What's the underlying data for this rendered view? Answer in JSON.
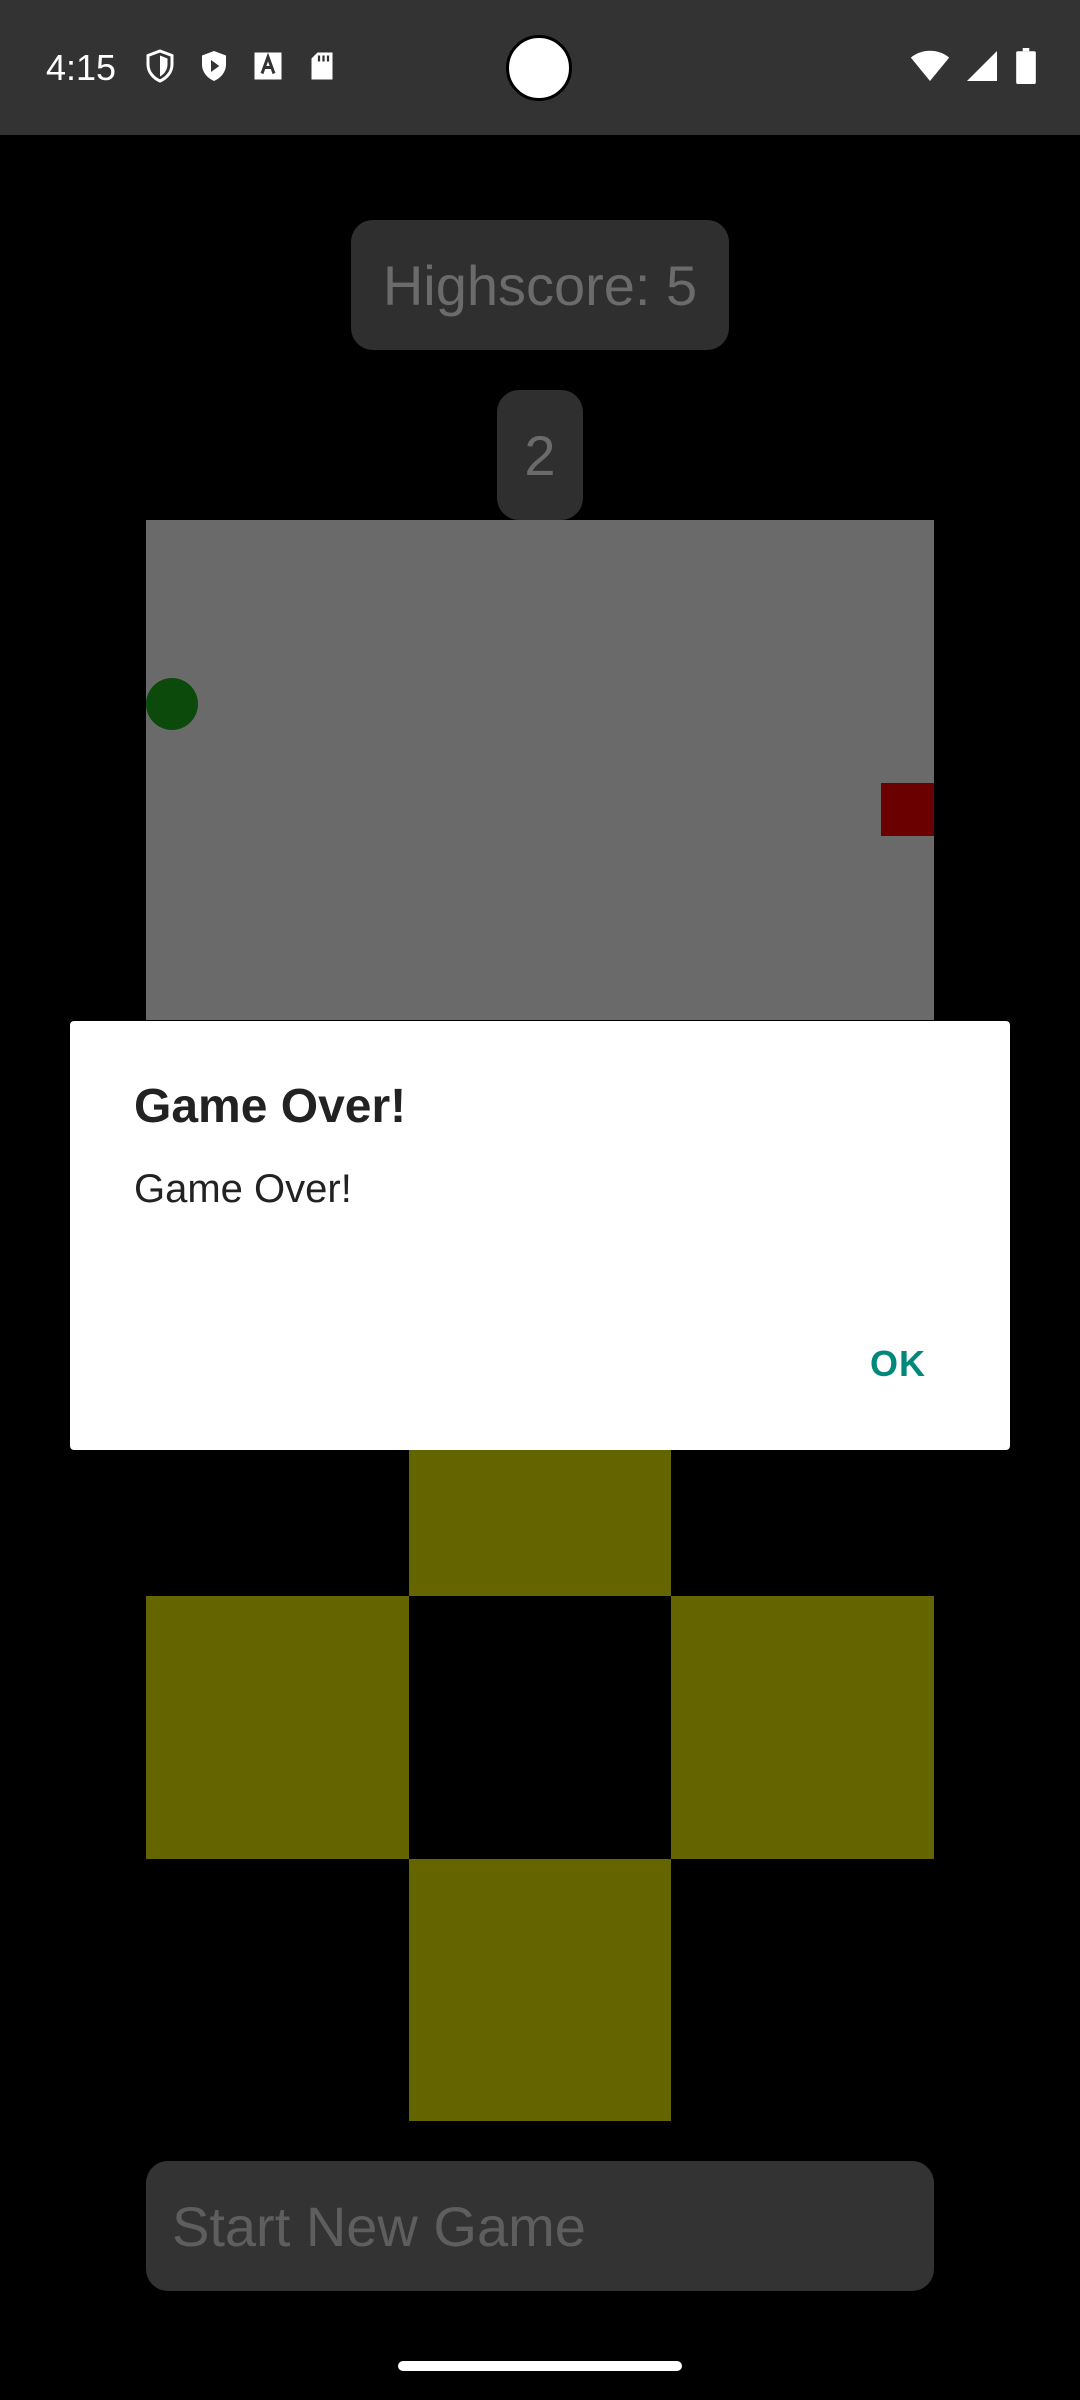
{
  "status_bar": {
    "time": "4:15",
    "left_icons": [
      "shield-icon",
      "play-shield-icon",
      "text-a-icon",
      "sd-card-icon"
    ],
    "right_icons": [
      "wifi-icon",
      "signal-icon",
      "battery-icon"
    ]
  },
  "game": {
    "highscore_label": "Highscore: 5",
    "score": "2",
    "start_button_label": "Start New Game",
    "colors": {
      "board": "#6a6a6a",
      "snake": "#0b4a0b",
      "food": "#6b0000",
      "dpad": "#656500"
    }
  },
  "dialog": {
    "title": "Game Over!",
    "message": "Game Over!",
    "ok_label": "OK",
    "ok_color": "#00897b"
  }
}
